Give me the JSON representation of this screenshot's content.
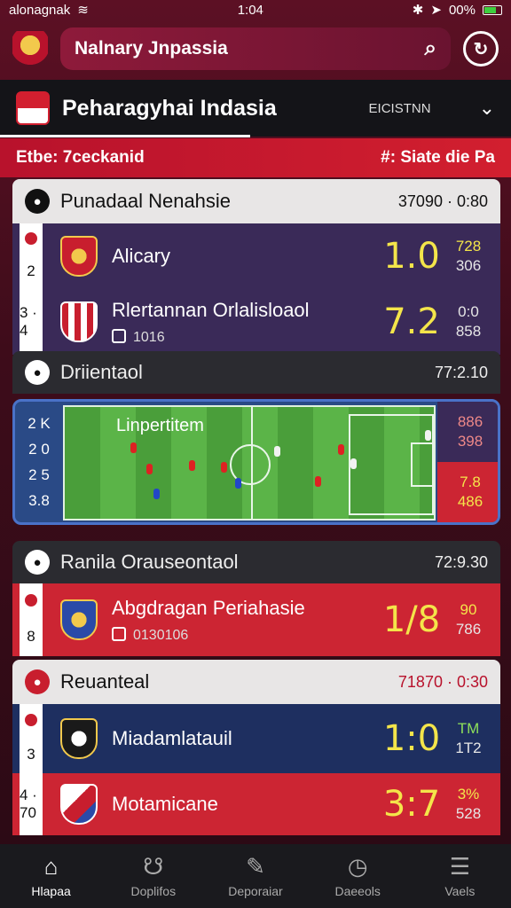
{
  "status": {
    "carrier": "alonagnak",
    "time": "1:04",
    "battery": "00%"
  },
  "search": {
    "text": "Nalnary Jnpassia"
  },
  "league": {
    "title": "Peharagyhai Indasia",
    "switch": "EICISTNN"
  },
  "info": {
    "left": "Etbe: 7ceckanid",
    "right": "#: Siate die Pa"
  },
  "sections": [
    {
      "title": "Punadaal Nenahsie",
      "time": "37090 · 0:80"
    },
    {
      "title": "Driientaol",
      "time": "77:2.10"
    },
    {
      "title": "Ranila Orauseontaol",
      "time": "72:9.30"
    },
    {
      "title": "Reuanteal",
      "time": "71870 · 0:30"
    }
  ],
  "matches": [
    {
      "rank": "2",
      "name": "Alicary",
      "sub": "",
      "score": "1.0",
      "odd1": "728",
      "odd2": "306"
    },
    {
      "rank": "3 · 4",
      "name": "Rlertannan Orlalisloaol",
      "sub": "1016",
      "score": "7.2",
      "odd1": "0:0",
      "odd2": "858"
    },
    {
      "rank": "8",
      "name": "Abgdragan Periahasie",
      "sub": "0130106",
      "score": "1/8",
      "odd1": "90",
      "odd2": "786"
    },
    {
      "rank": "3",
      "name": "Miadamlatauil",
      "sub": "",
      "score": "1:0",
      "odd1": "TM",
      "odd2": "1T2"
    },
    {
      "rank": "4 · 70",
      "name": "Motamicane",
      "sub": "",
      "score": "3:7",
      "odd1": "3%",
      "odd2": "528"
    }
  ],
  "live": {
    "title": "Linpertitem",
    "left1": "2 K",
    "left2": "2 0",
    "left3": "2 5",
    "left4": "3.8",
    "odd1": "886",
    "odd2": "398",
    "odd3": "7.8",
    "odd4": "486"
  },
  "nav": [
    {
      "label": "Hlapaa",
      "icon": "home-icon"
    },
    {
      "label": "Doplifos",
      "icon": "whistle-icon"
    },
    {
      "label": "Deporaiar",
      "icon": "edit-icon"
    },
    {
      "label": "Daeeols",
      "icon": "clock-icon"
    },
    {
      "label": "Vaels",
      "icon": "menu-icon"
    }
  ]
}
